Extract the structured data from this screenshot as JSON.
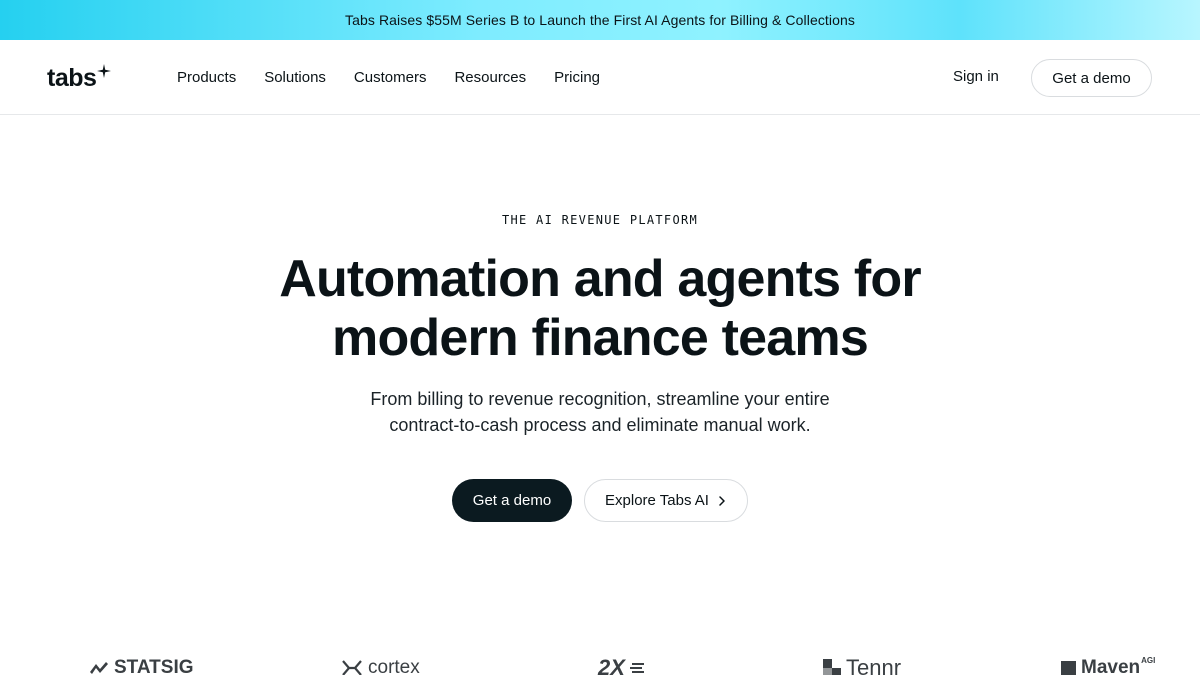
{
  "banner": {
    "text": "Tabs Raises $55M Series B to Launch the First AI Agents for Billing & Collections"
  },
  "nav": {
    "logo": "tabs",
    "links": [
      "Products",
      "Solutions",
      "Customers",
      "Resources",
      "Pricing"
    ],
    "signin": "Sign in",
    "demo": "Get a demo"
  },
  "hero": {
    "eyebrow": "THE AI REVENUE PLATFORM",
    "headline_line1": "Automation and agents for",
    "headline_line2": "modern finance teams",
    "subhead_line1": "From billing to revenue recognition, streamline your entire",
    "subhead_line2": "contract-to-cash process and eliminate manual work.",
    "cta_primary": "Get a demo",
    "cta_secondary": "Explore Tabs AI"
  },
  "customer_logos": {
    "statsig": "STATSIG",
    "cortex": "cortex",
    "twox": "2X",
    "tennr": "Tennr",
    "maven": "Maven",
    "maven_sup": "AGI"
  },
  "colors": {
    "banner_accent": "#25d0f0",
    "primary_button": "#0b1a20",
    "text": "#0b1317"
  }
}
